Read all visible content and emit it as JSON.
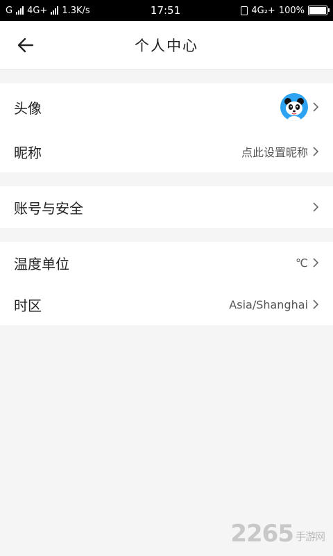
{
  "status_bar": {
    "carrier1": "G",
    "net1": "4G+",
    "speed": "1.3K/s",
    "time": "17:51",
    "net2": "4G₂+",
    "battery_pct": "100%",
    "battery_level": 1.0
  },
  "header": {
    "title": "个人中心",
    "back_icon": "arrow-left-icon"
  },
  "groups": [
    {
      "rows": [
        {
          "label": "头像",
          "value": "",
          "has_avatar": true
        },
        {
          "label": "昵称",
          "value": "点此设置昵称"
        }
      ]
    },
    {
      "rows": [
        {
          "label": "账号与安全",
          "value": ""
        }
      ]
    },
    {
      "rows": [
        {
          "label": "温度单位",
          "value": "℃"
        },
        {
          "label": "时区",
          "value": "Asia/Shanghai"
        }
      ]
    }
  ],
  "watermark": {
    "number": "2265",
    "suffix": "手游网"
  }
}
